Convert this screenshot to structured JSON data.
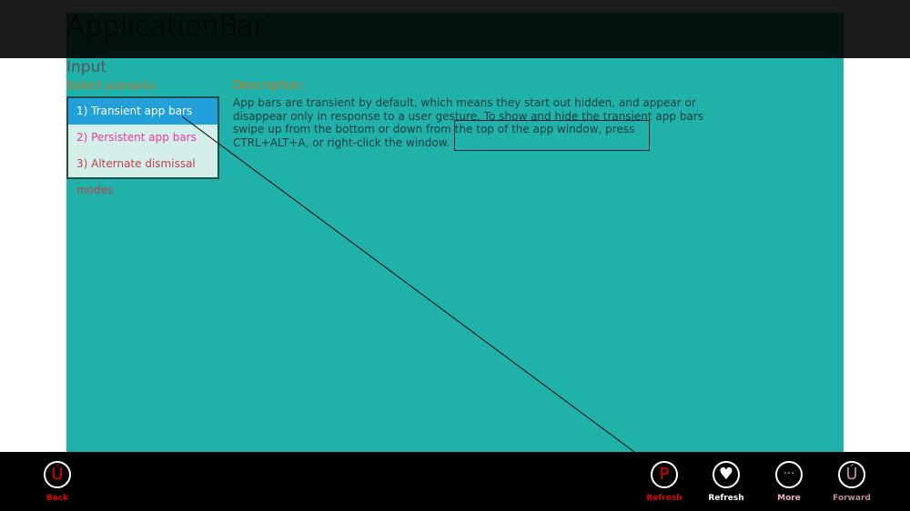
{
  "app_title": "ApplicationBar",
  "input_heading": "Input",
  "select_label": "Select scenario:",
  "scenarios": [
    {
      "label": "1) Transient app bars",
      "color": "#ffffff"
    },
    {
      "label": "2) Persistent app bars",
      "color": "#e83aa0"
    },
    {
      "label": "3) Alternate dismissal modes",
      "color": "#c0404a"
    }
  ],
  "description_heading": "Description:",
  "description": "App bars are transient by default, which means they start out hidden, and appear or disappear only in response to a user gesture. To show and hide the transient app bars swipe up from the bottom or down from the top of the app window, press CTRL+ALT+A, or right-click the window.",
  "appbar": {
    "back": {
      "glyph": "Ú",
      "label": "Back",
      "color": "#e00000"
    },
    "buttons": [
      {
        "glyph": "P",
        "label": "Refresh",
        "color": "#e00000"
      },
      {
        "glyph": "♥",
        "label": "Refresh",
        "color": "#ffffff"
      },
      {
        "glyph": "···",
        "label": "More",
        "color": "#f0b0c0"
      },
      {
        "glyph": "Ú",
        "label": "Forward",
        "color": "#c09098"
      }
    ]
  }
}
